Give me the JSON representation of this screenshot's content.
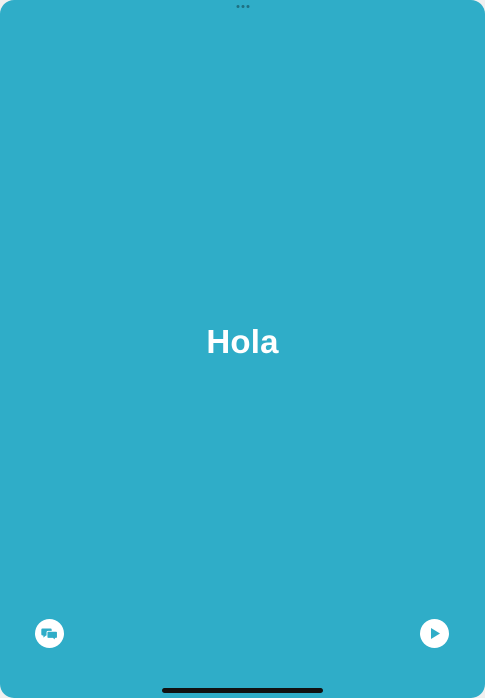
{
  "screen": {
    "background_color": "#2fadc8",
    "phrase": "Hola"
  },
  "controls": {
    "left_icon": "speech-bubbles-icon",
    "right_icon": "play-icon",
    "icon_color": "#2fadc8",
    "button_color": "#ffffff"
  }
}
